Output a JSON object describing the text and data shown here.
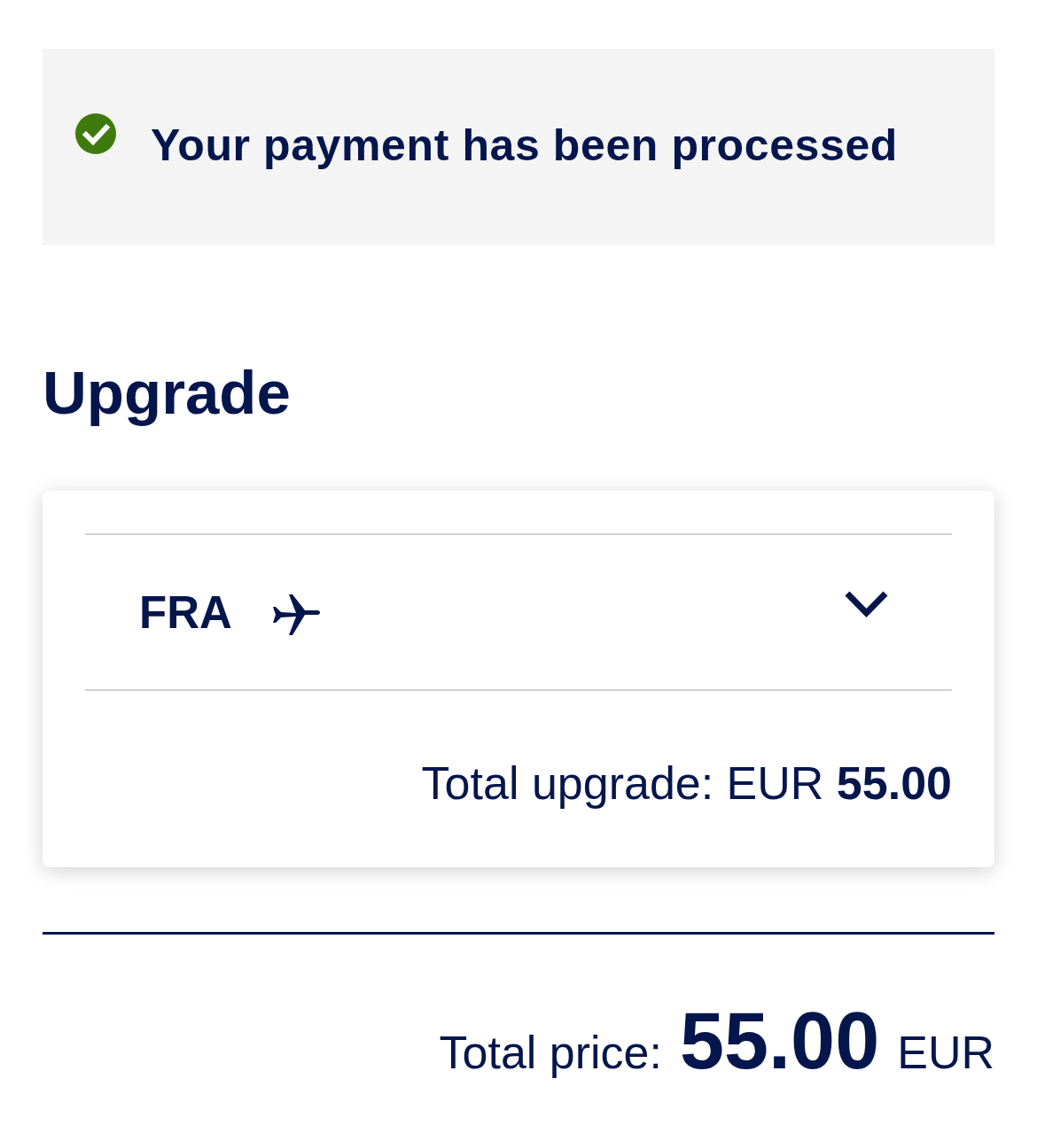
{
  "status_banner": {
    "kind": "success",
    "message": "Your payment has been processed"
  },
  "section_title": "Upgrade",
  "upgrade_card": {
    "flights": [
      {
        "origin": "FRA",
        "expanded": false
      }
    ],
    "total_text": "Total upgrade: EUR **55.00**"
  },
  "total_price": {
    "label": "Total price:",
    "amount": "55.00",
    "currency": "EUR"
  }
}
